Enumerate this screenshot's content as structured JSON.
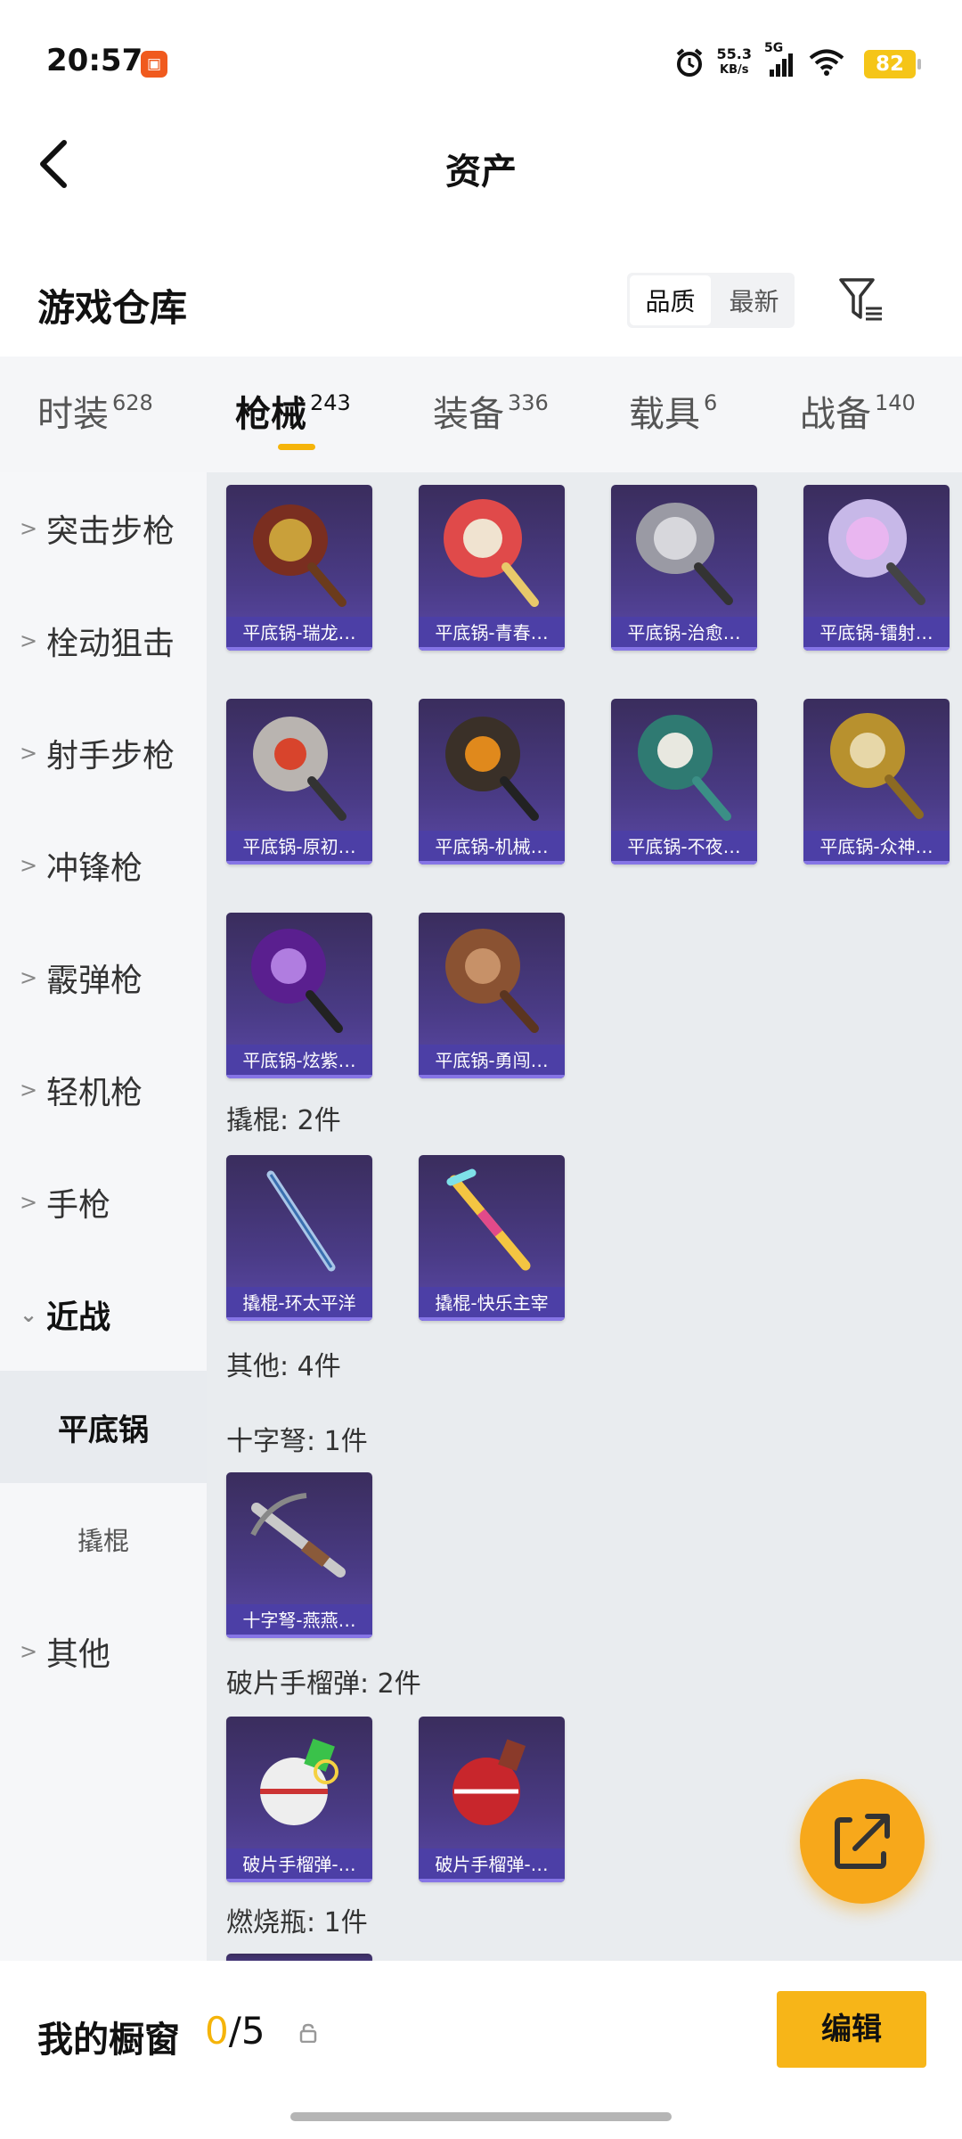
{
  "status": {
    "time": "20:57",
    "speed_value": "55.3",
    "speed_unit": "KB/s",
    "network": "5G",
    "battery": "82"
  },
  "header": {
    "title": "资产"
  },
  "warehouse": {
    "title": "游戏仓库",
    "sort_quality": "品质",
    "sort_newest": "最新"
  },
  "tabs": [
    {
      "label": "时装",
      "count": "628"
    },
    {
      "label": "枪械",
      "count": "243"
    },
    {
      "label": "装备",
      "count": "336"
    },
    {
      "label": "载具",
      "count": "6"
    },
    {
      "label": "战备",
      "count": "140"
    }
  ],
  "sidebar": {
    "items": [
      "突击步枪",
      "栓动狙击",
      "射手步枪",
      "冲锋枪",
      "霰弹枪",
      "轻机枪",
      "手枪",
      "近战"
    ],
    "sub_selected": "平底锅",
    "sub_other": "撬棍",
    "last": "其他"
  },
  "content": {
    "pans": [
      "平底锅-瑞龙…",
      "平底锅-青春…",
      "平底锅-治愈…",
      "平底锅-镭射…",
      "平底锅-原初…",
      "平底锅-机械…",
      "平底锅-不夜…",
      "平底锅-众神…",
      "平底锅-炫紫…",
      "平底锅-勇闯…"
    ],
    "crowbar_label": "撬棍: 2件",
    "crowbars": [
      "撬棍-环太平洋",
      "撬棍-快乐主宰"
    ],
    "other_label": "其他: 4件",
    "crossbow_label": "十字弩: 1件",
    "crossbows": [
      "十字弩-燕燕…"
    ],
    "grenade_label": "破片手榴弹: 2件",
    "grenades": [
      "破片手榴弹-…",
      "破片手榴弹-…"
    ],
    "molotov_label": "燃烧瓶: 1件"
  },
  "bottom": {
    "title": "我的橱窗",
    "count_current": "0",
    "count_total": "/5",
    "edit": "编辑"
  },
  "colors": {
    "accent": "#f7b518",
    "card": "#4c3fa6"
  }
}
